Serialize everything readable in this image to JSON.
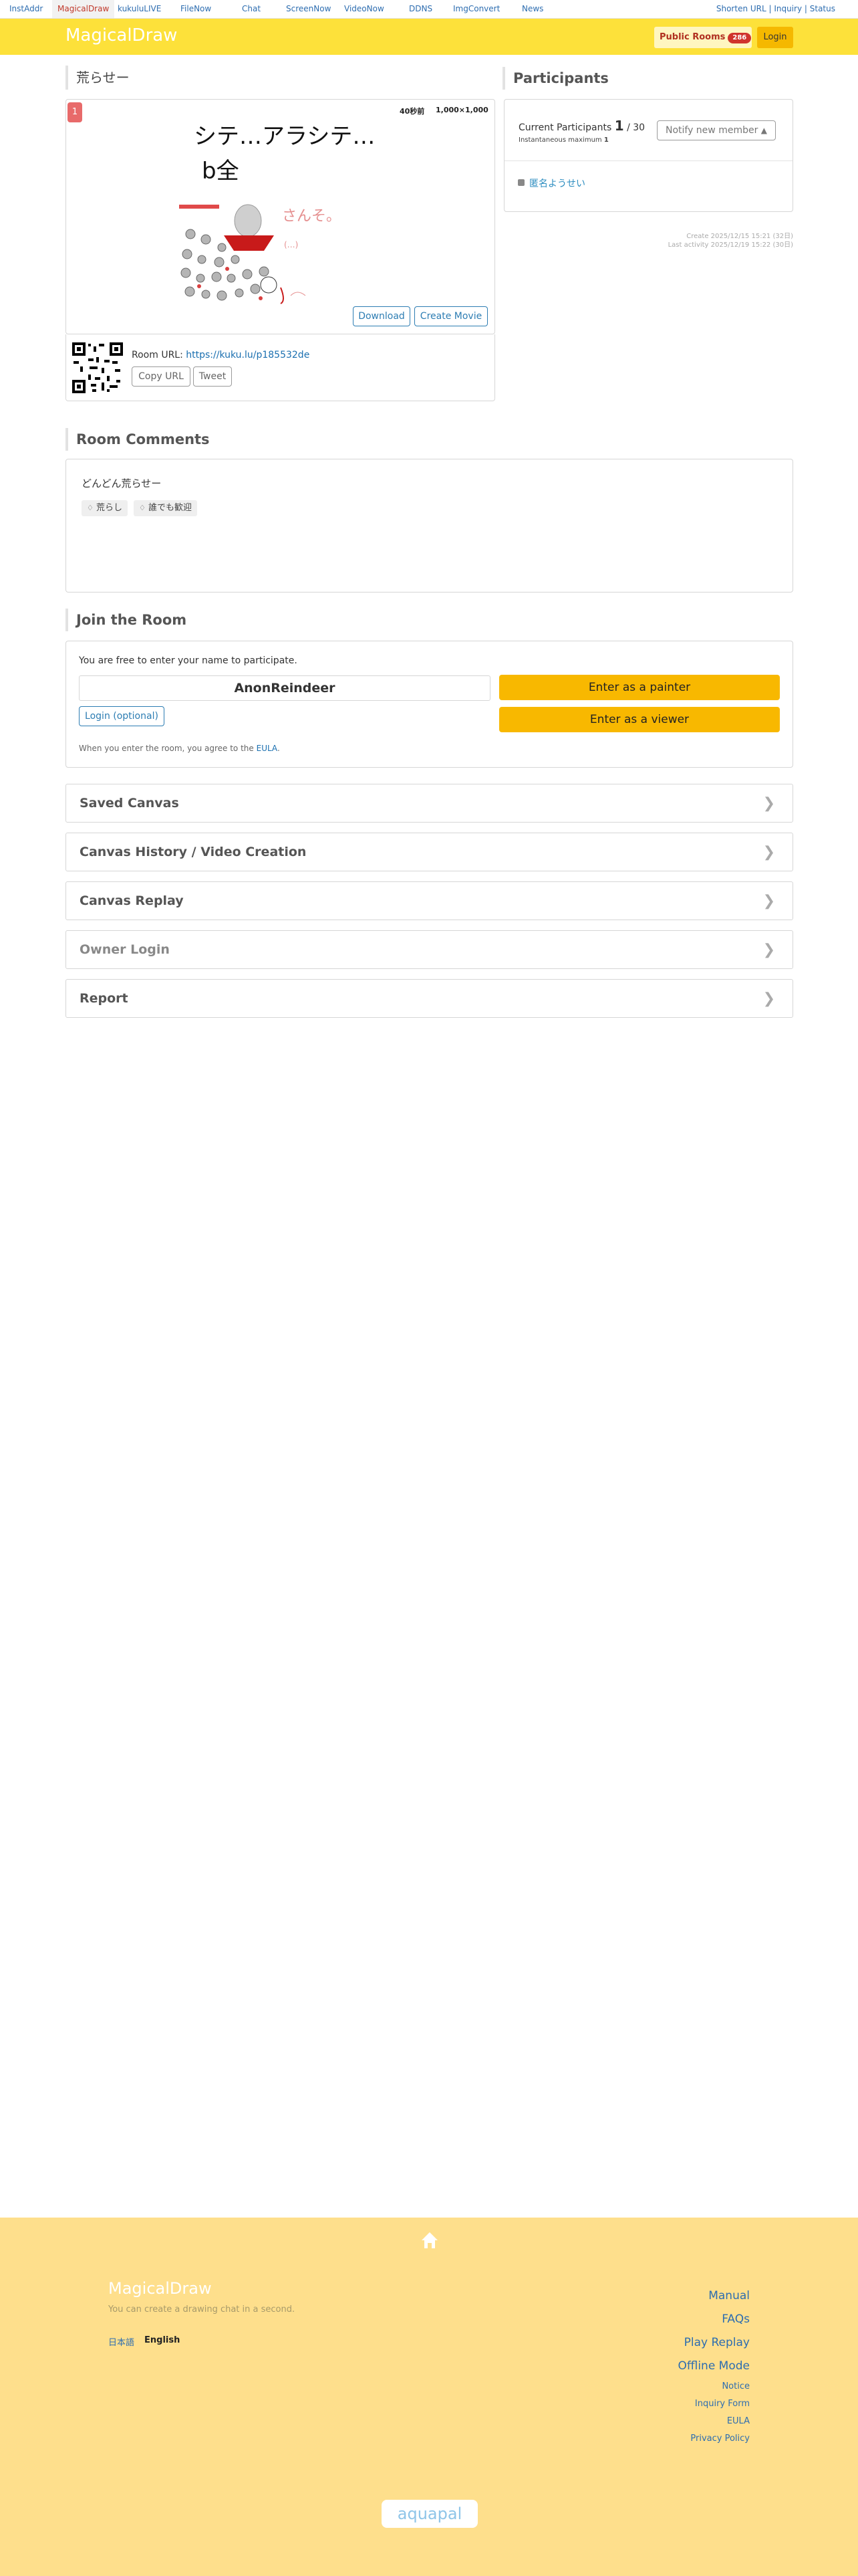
{
  "topbar": {
    "services": [
      "InstAddr",
      "MagicalDraw",
      "kukuluLIVE",
      "FileNow",
      "Chat",
      "ScreenNow",
      "VideoNow",
      "DDNS",
      "ImgConvert",
      "News"
    ],
    "right_links": "Shorten URL | Inquiry | Status"
  },
  "header": {
    "logo": "MagicalDraw",
    "public_rooms_label": "Public Rooms",
    "public_rooms_count": "286",
    "login_label": "Login"
  },
  "room": {
    "title": "荒らせー",
    "rank": "1",
    "elapsed": "40秒前",
    "canvas_size": "1,000×1,000",
    "canvas_handwriting_line1": "シテ…アラシテ…",
    "canvas_handwriting_line2": "b全",
    "download_label": "Download",
    "create_movie_label": "Create Movie",
    "url_label": "Room URL:",
    "url": "https://kuku.lu/p185532de",
    "copy_url_label": "Copy URL",
    "tweet_label": "Tweet"
  },
  "participants": {
    "title": "Participants",
    "current_label": "Current Participants",
    "current_count": "1",
    "max_label": "/ 30",
    "instant_max_label": "Instantaneous maximum",
    "instant_max_value": "1",
    "notify_label": "Notify new member",
    "members": [
      "匿名ようせい"
    ],
    "created": "Create 2025/12/15 15:21 (32日)",
    "last_activity": "Last activity 2025/12/19 15:22 (30日)"
  },
  "comments": {
    "title": "Room Comments",
    "text": "どんどん荒らせー",
    "tags": [
      "荒らし",
      "誰でも歓迎"
    ]
  },
  "join": {
    "title": "Join the Room",
    "intro": "You are free to enter your name to participate.",
    "name_value": "AnonReindeer",
    "login_optional_label": "Login (optional)",
    "painter_label": "Enter as a painter",
    "viewer_label": "Enter as a viewer",
    "eula_prefix": "When you enter the room, you agree to the",
    "eula_link": "EULA",
    "eula_suffix": "."
  },
  "accordions": [
    "Saved Canvas",
    "Canvas History / Video Creation",
    "Canvas Replay",
    "Owner Login",
    "Report"
  ],
  "footer": {
    "logo": "MagicalDraw",
    "tagline": "You can create a drawing chat in a second.",
    "lang_ja": "日本語",
    "lang_en": "English",
    "links_big": [
      "Manual",
      "FAQs",
      "Play Replay",
      "Offline Mode"
    ],
    "links_small": [
      "Notice",
      "Inquiry Form",
      "EULA",
      "Privacy Policy"
    ],
    "brand": "aquapal"
  },
  "colors": {
    "header_yellow": "#fde13a",
    "button_yellow": "#f8b800",
    "footer_yellow": "#fedf8c",
    "link_blue": "#2d7db3",
    "badge_red": "#d0342c"
  }
}
